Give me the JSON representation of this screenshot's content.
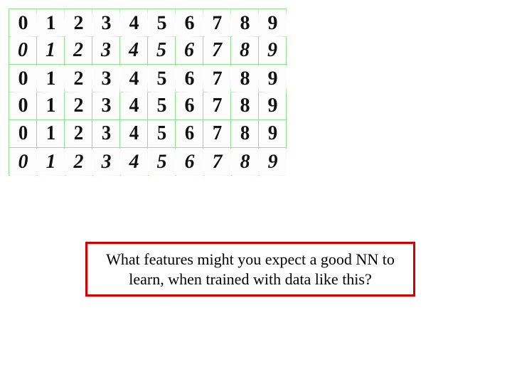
{
  "digits": {
    "rows": [
      [
        "0",
        "1",
        "2",
        "3",
        "4",
        "5",
        "6",
        "7",
        "8",
        "9"
      ],
      [
        "0",
        "1",
        "2",
        "3",
        "4",
        "5",
        "6",
        "7",
        "8",
        "9"
      ],
      [
        "0",
        "1",
        "2",
        "3",
        "4",
        "5",
        "6",
        "7",
        "8",
        "9"
      ],
      [
        "0",
        "1",
        "2",
        "3",
        "4",
        "5",
        "6",
        "7",
        "8",
        "9"
      ],
      [
        "0",
        "1",
        "2",
        "3",
        "4",
        "5",
        "6",
        "7",
        "8",
        "9"
      ],
      [
        "0",
        "1",
        "2",
        "3",
        "4",
        "5",
        "6",
        "7",
        "8",
        "9"
      ]
    ]
  },
  "question": {
    "text": "What features might you expect a good NN to learn, when trained with data like this?"
  }
}
